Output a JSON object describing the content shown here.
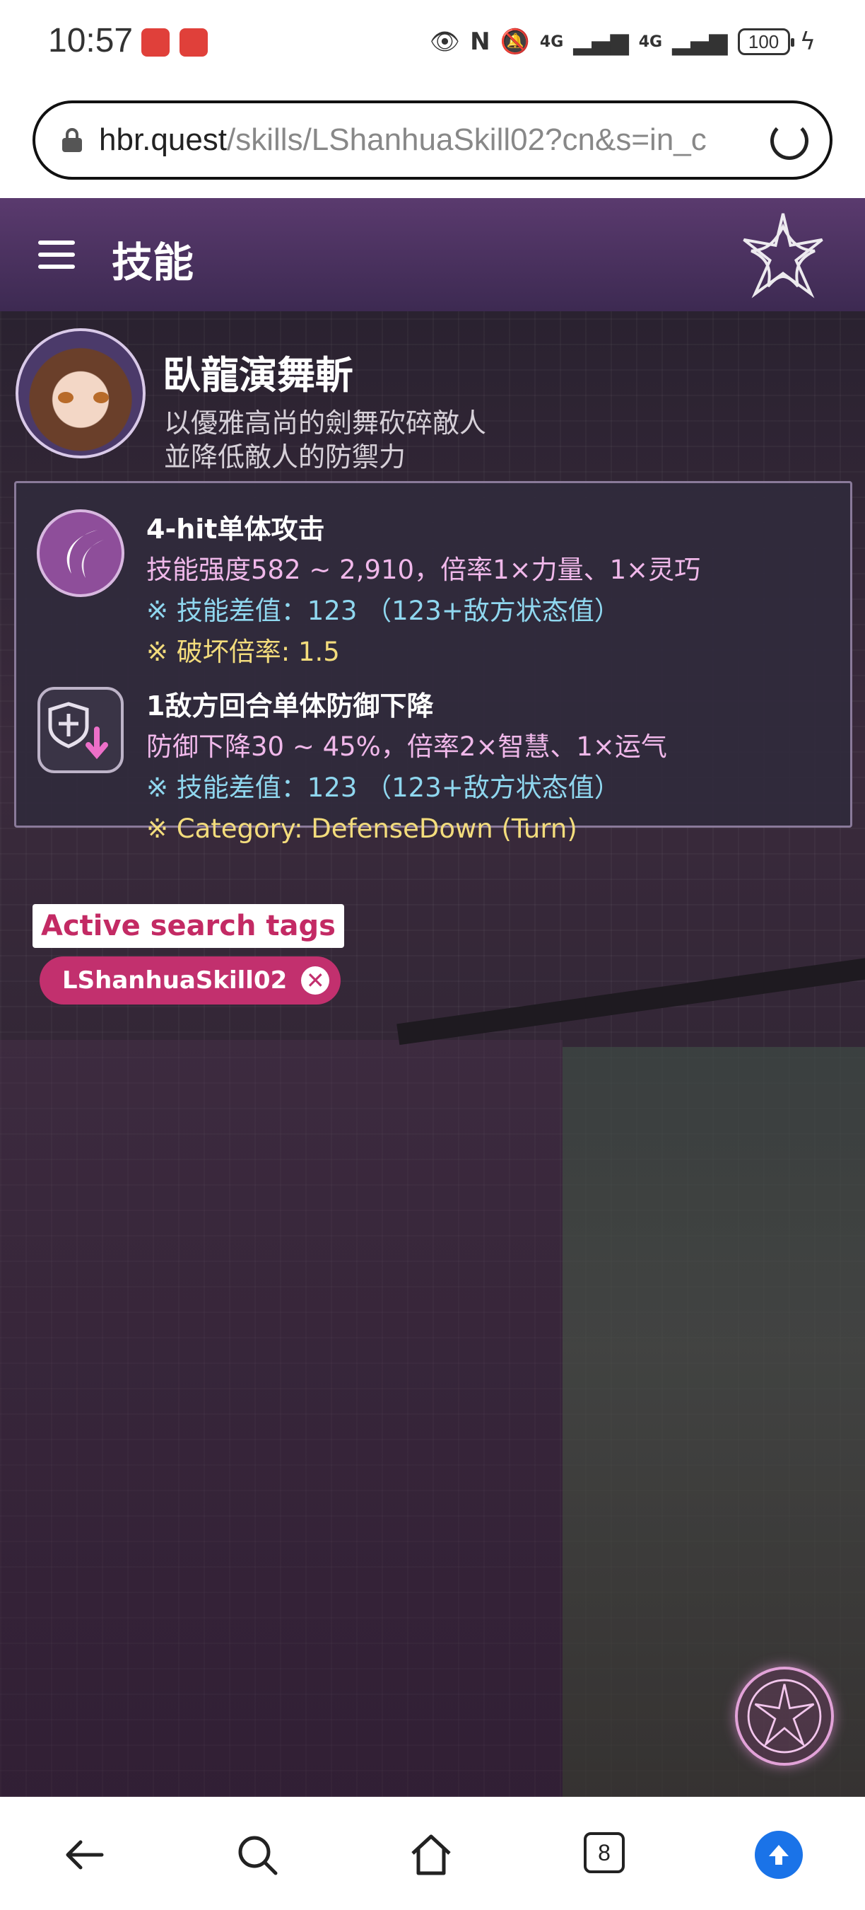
{
  "status_bar": {
    "time": "10:57",
    "network_1": "4G",
    "network_2": "4G",
    "battery": "100"
  },
  "browser": {
    "url_host": "hbr.quest",
    "url_path": "/skills/LShanhuaSkill02?cn&s=in_c",
    "tab_count": "8"
  },
  "header": {
    "title": "技能"
  },
  "skill": {
    "name": "臥龍演舞斬",
    "description_line1": "以優雅高尚的劍舞砍碎敵人",
    "description_line2": "並降低敵人的防禦力"
  },
  "effects": [
    {
      "title": "4-hit单体攻击",
      "line1": "技能强度582 ~ 2,910，倍率1×力量、1×灵巧",
      "line2": "※ 技能差值：123 （123+敌方状态值）",
      "line3": "※ 破坏倍率: 1.5",
      "icon": "slash-attack-icon"
    },
    {
      "title": "1敌方回合单体防御下降",
      "line1": "防御下降30 ~ 45%，倍率2×智慧、1×运气",
      "line2": "※ 技能差值：123 （123+敌方状态值）",
      "line3": "※ Category: DefenseDown (Turn)",
      "icon": "defense-down-icon"
    }
  ],
  "tags": {
    "label": "Active search tags",
    "items": [
      "LShanhuaSkill02"
    ],
    "close_glyph": "✕"
  },
  "colors": {
    "header_bg": "#4a3260",
    "accent_pink": "#c2306e",
    "text_pink": "#f0b8ea",
    "text_cyan": "#8fd7ef",
    "text_yellow": "#f3dc7c"
  }
}
